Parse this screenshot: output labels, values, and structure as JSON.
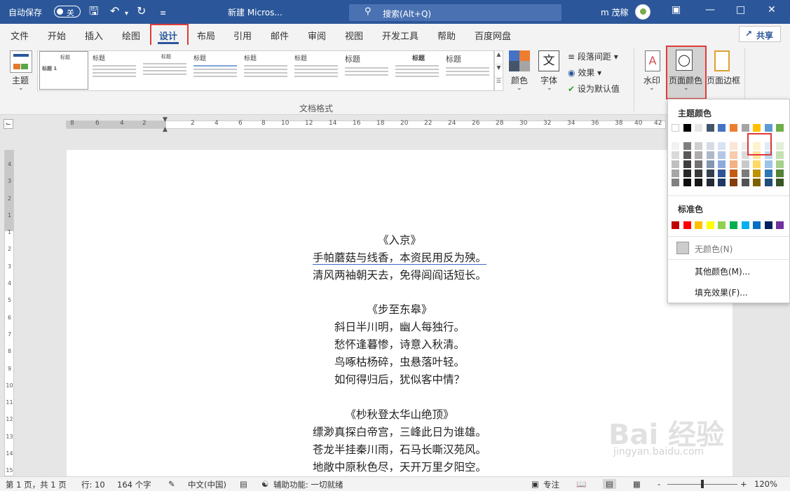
{
  "titlebar": {
    "autosave_label": "自动保存",
    "autosave_state": "关",
    "doc_title": "新建 Micros...",
    "search_placeholder": "搜索(Alt+Q)",
    "user_name": "m 茂稼"
  },
  "tabs": [
    "文件",
    "开始",
    "插入",
    "绘图",
    "设计",
    "布局",
    "引用",
    "邮件",
    "审阅",
    "视图",
    "开发工具",
    "帮助",
    "百度网盘"
  ],
  "active_tab": "设计",
  "share_label": "共享",
  "ribbon": {
    "theme_label": "主题",
    "gallery_group_label": "文档格式",
    "style_thumbs": [
      "标题",
      "标题",
      "标题",
      "标题",
      "标题",
      "标题",
      "标题",
      "标题",
      "标题"
    ],
    "style_first_title": "标题",
    "style_first_sub": "标题 1",
    "colors_label": "颜色",
    "fonts_label": "字体",
    "paragraph_spacing_label": "段落间距",
    "effects_label": "效果",
    "set_default_label": "设为默认值",
    "watermark_label": "水印",
    "page_color_label": "页面颜色",
    "page_border_label": "页面边框"
  },
  "ruler_numbers": [
    "8",
    "6",
    "4",
    "2",
    "2",
    "4",
    "6",
    "8",
    "10",
    "12",
    "14",
    "16",
    "18",
    "20",
    "22",
    "24",
    "26",
    "28",
    "30",
    "32",
    "34",
    "36",
    "38",
    "40",
    "42"
  ],
  "vruler_numbers": [
    "4",
    "3",
    "2",
    "1",
    "1",
    "2",
    "3",
    "4",
    "5",
    "6",
    "7",
    "8",
    "9",
    "10",
    "11",
    "12",
    "13",
    "14",
    "15"
  ],
  "poems": [
    {
      "title": "《入京》",
      "lines": [
        "手帕蘑菇与线香，本资民用反为殃。",
        "清风两袖朝天去，免得闾阎话短长。"
      ]
    },
    {
      "title": "《步至东皋》",
      "lines": [
        "斜日半川明，幽人每独行。",
        "愁怀逢暮惨，诗意入秋清。",
        "鸟啄枯杨碎，虫悬落叶轻。",
        "如何得归后，犹似客中情？"
      ]
    },
    {
      "title": "《杪秋登太华山绝顶》",
      "lines": [
        "缥渺真探白帝宫，三峰此日为谁雄。",
        "苍龙半挂秦川雨，石马长嘶汉苑风。",
        "地敞中原秋色尽，天开万里夕阳空。"
      ]
    }
  ],
  "dropdown": {
    "theme_colors_label": "主题颜色",
    "standard_colors_label": "标准色",
    "no_color_label": "无颜色(N)",
    "more_colors_label": "其他颜色(M)...",
    "fill_effects_label": "填充效果(F)...",
    "theme_top_row": [
      "#ffffff",
      "#000000",
      "#e7e6e6",
      "#44546a",
      "#4472c4",
      "#ed7d31",
      "#a5a5a5",
      "#ffc000",
      "#5b9bd5",
      "#70ad47"
    ],
    "theme_shades": [
      [
        "#f2f2f2",
        "#d9d9d9",
        "#bfbfbf",
        "#a6a6a6",
        "#808080"
      ],
      [
        "#7f7f7f",
        "#595959",
        "#3f3f3f",
        "#262626",
        "#0d0d0d"
      ],
      [
        "#d0cece",
        "#aeabab",
        "#757171",
        "#3a3838",
        "#171616"
      ],
      [
        "#d6dce4",
        "#adb9ca",
        "#8496b0",
        "#333f4f",
        "#222a35"
      ],
      [
        "#d9e2f3",
        "#b4c6e7",
        "#8eaadb",
        "#2f5496",
        "#1f3864"
      ],
      [
        "#fbe5d5",
        "#f7cbac",
        "#f4b183",
        "#c55a11",
        "#843c0b"
      ],
      [
        "#ededed",
        "#dbdbdb",
        "#c9c9c9",
        "#7b7b7b",
        "#525252"
      ],
      [
        "#fff2cc",
        "#fee599",
        "#ffd965",
        "#bf9000",
        "#7f6000"
      ],
      [
        "#deebf6",
        "#bdd7ee",
        "#9dc3e6",
        "#2e75b5",
        "#1e4e79"
      ],
      [
        "#e2efd9",
        "#c5e0b3",
        "#a8d08d",
        "#538135",
        "#375623"
      ]
    ],
    "standard_colors": [
      "#c00000",
      "#ff0000",
      "#ffc000",
      "#ffff00",
      "#92d050",
      "#00b050",
      "#00b0f0",
      "#0070c0",
      "#002060",
      "#7030a0"
    ]
  },
  "status": {
    "page_info": "第 1 页，共 1 页",
    "line_info": "行: 10",
    "word_count": "164 个字",
    "language": "中文(中国)",
    "accessibility": "辅助功能: 一切就绪",
    "focus_label": "专注",
    "zoom": "120%",
    "zoom_minus": "-",
    "zoom_plus": "+"
  },
  "watermark_text": "Bai 经验",
  "watermark_url": "jingyan.baidu.com"
}
